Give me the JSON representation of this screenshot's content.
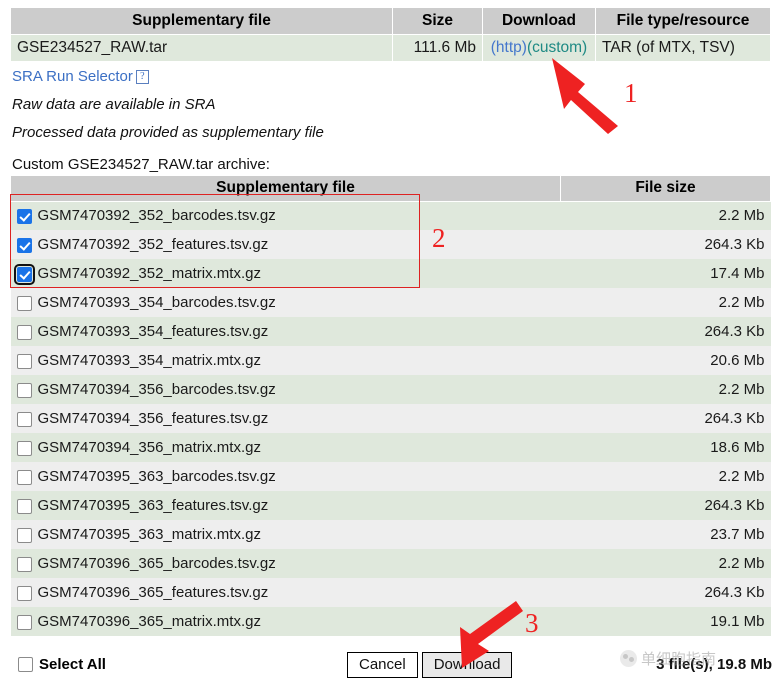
{
  "top_table": {
    "columns": [
      "Supplementary file",
      "Size",
      "Download",
      "File type/resource"
    ],
    "rows": [
      {
        "name": "GSE234527_RAW.tar",
        "size": "111.6 Mb",
        "download_http": "(http)",
        "download_custom": "(custom)",
        "type": "TAR (of MTX, TSV)"
      }
    ]
  },
  "notes": {
    "sra_link": "SRA Run Selector",
    "help_icon_glyph": "?",
    "line1": "Raw data are available in SRA",
    "line2": "Processed data provided as supplementary file"
  },
  "archive": {
    "caption": "Custom GSE234527_RAW.tar archive:",
    "columns": [
      "Supplementary file",
      "File size"
    ],
    "files": [
      {
        "name": "GSM7470392_352_barcodes.tsv.gz",
        "size": "2.2 Mb",
        "checked": true,
        "focused": false
      },
      {
        "name": "GSM7470392_352_features.tsv.gz",
        "size": "264.3 Kb",
        "checked": true,
        "focused": false
      },
      {
        "name": "GSM7470392_352_matrix.mtx.gz",
        "size": "17.4 Mb",
        "checked": true,
        "focused": true
      },
      {
        "name": "GSM7470393_354_barcodes.tsv.gz",
        "size": "2.2 Mb",
        "checked": false,
        "focused": false
      },
      {
        "name": "GSM7470393_354_features.tsv.gz",
        "size": "264.3 Kb",
        "checked": false,
        "focused": false
      },
      {
        "name": "GSM7470393_354_matrix.mtx.gz",
        "size": "20.6 Mb",
        "checked": false,
        "focused": false
      },
      {
        "name": "GSM7470394_356_barcodes.tsv.gz",
        "size": "2.2 Mb",
        "checked": false,
        "focused": false
      },
      {
        "name": "GSM7470394_356_features.tsv.gz",
        "size": "264.3 Kb",
        "checked": false,
        "focused": false
      },
      {
        "name": "GSM7470394_356_matrix.mtx.gz",
        "size": "18.6 Mb",
        "checked": false,
        "focused": false
      },
      {
        "name": "GSM7470395_363_barcodes.tsv.gz",
        "size": "2.2 Mb",
        "checked": false,
        "focused": false
      },
      {
        "name": "GSM7470395_363_features.tsv.gz",
        "size": "264.3 Kb",
        "checked": false,
        "focused": false
      },
      {
        "name": "GSM7470395_363_matrix.mtx.gz",
        "size": "23.7 Mb",
        "checked": false,
        "focused": false
      },
      {
        "name": "GSM7470396_365_barcodes.tsv.gz",
        "size": "2.2 Mb",
        "checked": false,
        "focused": false
      },
      {
        "name": "GSM7470396_365_features.tsv.gz",
        "size": "264.3 Kb",
        "checked": false,
        "focused": false
      },
      {
        "name": "GSM7470396_365_matrix.mtx.gz",
        "size": "19.1 Mb",
        "checked": false,
        "focused": false
      }
    ]
  },
  "footer": {
    "select_all_label": "Select All",
    "select_all_checked": false,
    "cancel_label": "Cancel",
    "download_label": "Download",
    "status": "3 file(s), 19.8 Mb"
  },
  "annotations": {
    "marker_1": "1",
    "marker_2": "2",
    "marker_3": "3",
    "color": "#ee2222"
  },
  "watermark": {
    "text": "单细胞指南"
  }
}
